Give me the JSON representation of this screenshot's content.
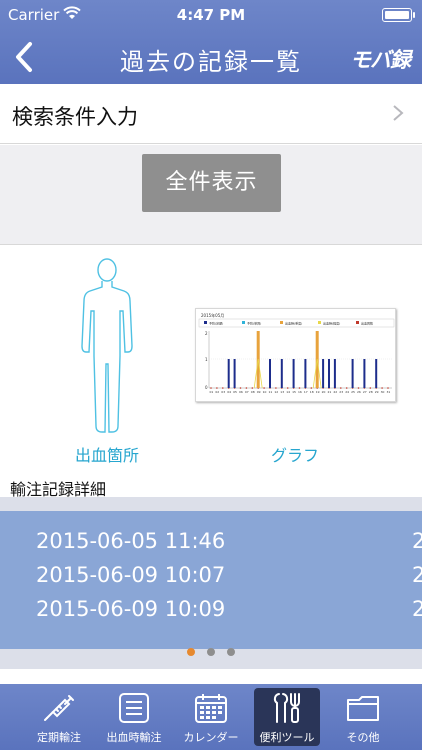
{
  "status_bar": {
    "carrier": "Carrier",
    "time": "4:47 PM"
  },
  "nav": {
    "title": "過去の記録一覧",
    "logo": "モバ録"
  },
  "search": {
    "label": "検索条件入力"
  },
  "show_all_button": "全件表示",
  "tools": {
    "body_label": "出血箇所",
    "graph_label": "グラフ",
    "graph_thumbnail": {
      "title": "2015年05月",
      "legend": [
        "予防(定期)",
        "予防(単回)",
        "出血時(重度)",
        "出血時(軽度)",
        "出血回数"
      ],
      "x_ticks": [
        "01",
        "02",
        "03",
        "04",
        "05",
        "06",
        "07",
        "08",
        "09",
        "10",
        "11",
        "12",
        "13",
        "14",
        "15",
        "16",
        "17",
        "18",
        "19",
        "20",
        "21",
        "22",
        "23",
        "24",
        "25",
        "26",
        "27",
        "28",
        "29",
        "30",
        "31"
      ]
    }
  },
  "section_title": "輸注記録詳細",
  "records": [
    "2015-06-05 11:46",
    "2015-06-09 10:07",
    "2015-06-09 10:09"
  ],
  "records_next": [
    "2",
    "2",
    "2"
  ],
  "tabbar": {
    "items": [
      {
        "label": "定期輸注",
        "icon": "syringe-icon"
      },
      {
        "label": "出血時輸注",
        "icon": "list-icon"
      },
      {
        "label": "カレンダー",
        "icon": "calendar-icon"
      },
      {
        "label": "便利ツール",
        "icon": "tools-icon",
        "active": true
      },
      {
        "label": "その他",
        "icon": "folder-icon"
      }
    ]
  },
  "colors": {
    "header": "#6078c0",
    "accent_link": "#27a6cf",
    "records_bg": "#8aa6d6",
    "active_dot": "#e6892f"
  }
}
